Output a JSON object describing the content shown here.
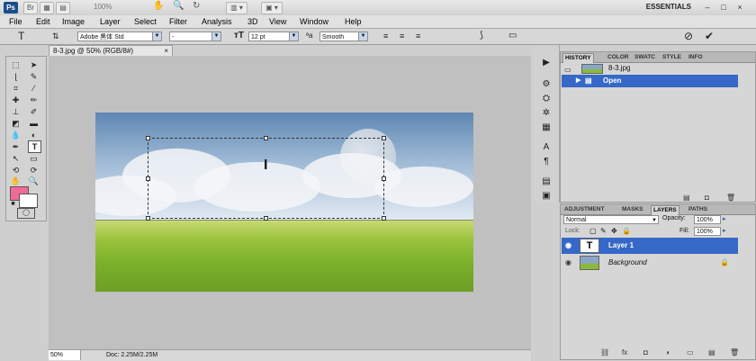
{
  "appbar": {
    "logo": "Ps",
    "zoom": "100%",
    "workspace": "ESSENTIALS",
    "window_controls": [
      "–",
      "□",
      "×"
    ]
  },
  "menu": [
    "File",
    "Edit",
    "Image",
    "Layer",
    "Select",
    "Filter",
    "Analysis",
    "3D",
    "View",
    "Window",
    "Help"
  ],
  "options": {
    "tool_glyph": "T",
    "font_family": "Adobe 黑体 Std",
    "font_style": "-",
    "font_size": "12 pt",
    "aa_label": "ªa",
    "antialias": "Smooth"
  },
  "document": {
    "tab_title": "8-3.jpg @ 50% (RGB/8#)",
    "tab_close": "×",
    "zoom": "50%",
    "doc_info": "Doc: 2.25M/2.25M"
  },
  "history": {
    "tabs": [
      "HISTORY",
      "COLOR",
      "SWATC",
      "STYLE",
      "INFO"
    ],
    "snapshot": "8-3.jpg",
    "states": [
      "Open"
    ]
  },
  "layers": {
    "tabs": [
      "ADJUSTMENT",
      "MASKS",
      "LAYERS",
      "PATHS"
    ],
    "blend_mode": "Normal",
    "opacity_label": "Opacity:",
    "opacity": "100%",
    "lock_label": "Lock:",
    "fill_label": "Fill:",
    "fill": "100%",
    "items": [
      {
        "name": "Layer 1",
        "thumb": "T"
      },
      {
        "name": "Background"
      }
    ]
  },
  "colors": {
    "foreground": "#ef6b95",
    "background": "#ffffff",
    "selection": "#3568c7"
  }
}
